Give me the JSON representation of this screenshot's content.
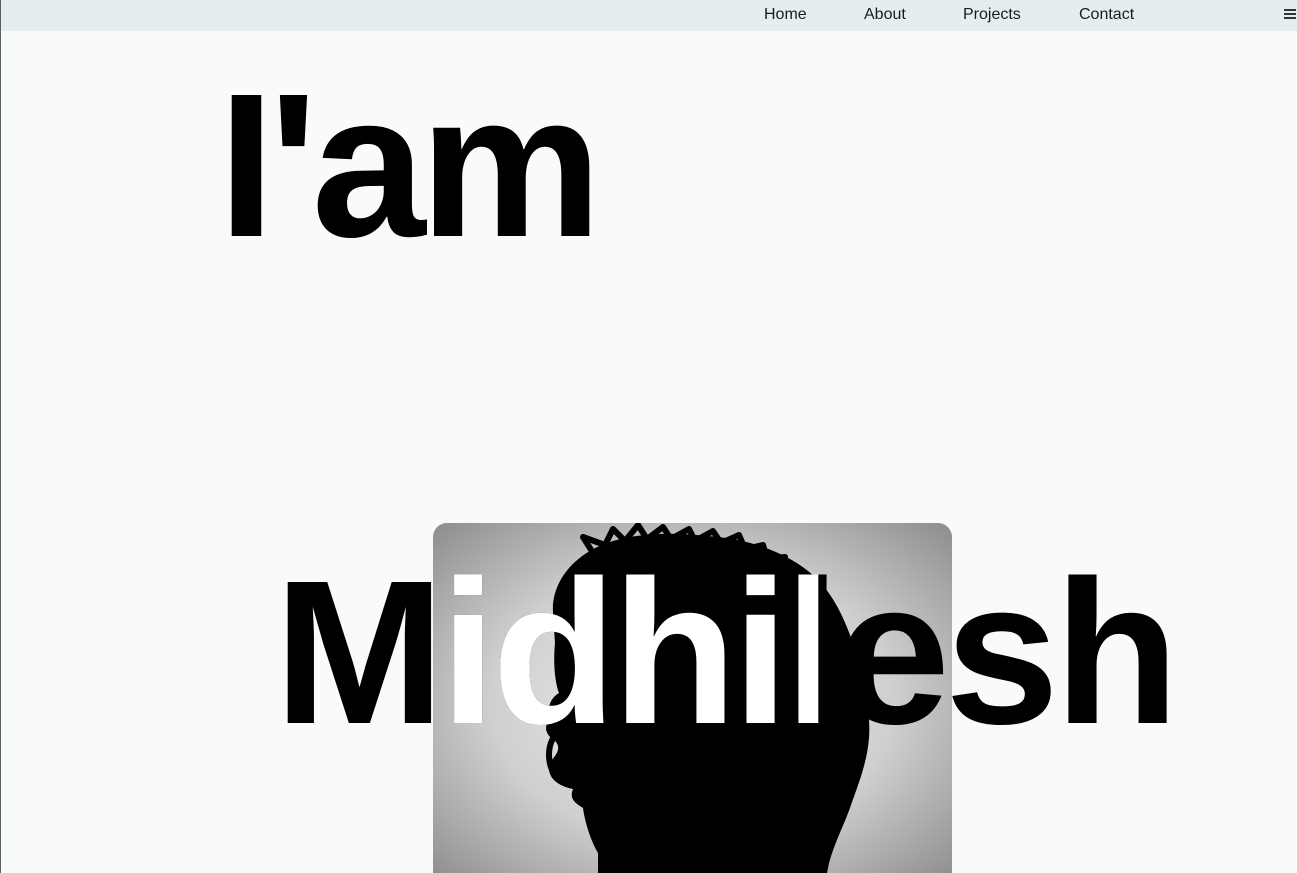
{
  "nav": {
    "links": [
      {
        "label": "Home"
      },
      {
        "label": "About"
      },
      {
        "label": "Projects"
      },
      {
        "label": "Contact"
      }
    ],
    "menu_icon": "hamburger-menu-icon"
  },
  "hero": {
    "intro": "I'am",
    "name": "Midhilesh"
  },
  "colors": {
    "background": "#f9fbfb",
    "navbar": "#e4edef",
    "text": "#000000",
    "name_overlay": "#ffffff"
  }
}
